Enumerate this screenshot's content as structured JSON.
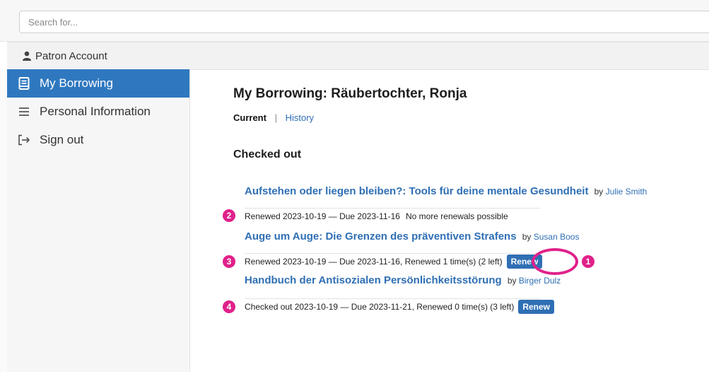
{
  "search": {
    "placeholder": "Search for..."
  },
  "account_bar": {
    "label": "Patron Account",
    "icon": "person-icon"
  },
  "sidebar": {
    "items": [
      {
        "label": "My Borrowing",
        "icon": "book-icon",
        "active": true
      },
      {
        "label": "Personal Information",
        "icon": "list-icon",
        "active": false
      },
      {
        "label": "Sign out",
        "icon": "sign-out-icon",
        "active": false
      }
    ]
  },
  "main": {
    "title": "My Borrowing: Räubertochter, Ronja",
    "subnav": {
      "current": "Current",
      "separator": "|",
      "history": "History"
    },
    "section_title": "Checked out",
    "by_label": "by",
    "items": [
      {
        "title": "Aufstehen oder liegen bleiben?: Tools für deine mentale Gesundheit",
        "author": "Julie Smith",
        "status": "Renewed 2023-10-19 — Due 2023-11-16",
        "note": "No more renewals possible",
        "renew_label": ""
      },
      {
        "title": "Auge um Auge: Die Grenzen des präventiven Strafens",
        "author": "Susan Boos",
        "status": "Renewed 2023-10-19 — Due 2023-11-16, Renewed 1 time(s) (2 left)",
        "note": "",
        "renew_label": "Renew"
      },
      {
        "title": "Handbuch der Antisozialen Persönlichkeitsstörung",
        "author": "Birger Dulz",
        "status": "Checked out 2023-10-19 — Due 2023-11-21, Renewed 0 time(s) (3 left)",
        "note": "",
        "renew_label": "Renew"
      }
    ]
  },
  "annotations": {
    "badges": [
      "1",
      "2",
      "3",
      "4"
    ],
    "color": "#e0218a"
  },
  "colors": {
    "accent": "#2f78bf",
    "link": "#2f6fb4",
    "annotation": "#e0218a"
  }
}
